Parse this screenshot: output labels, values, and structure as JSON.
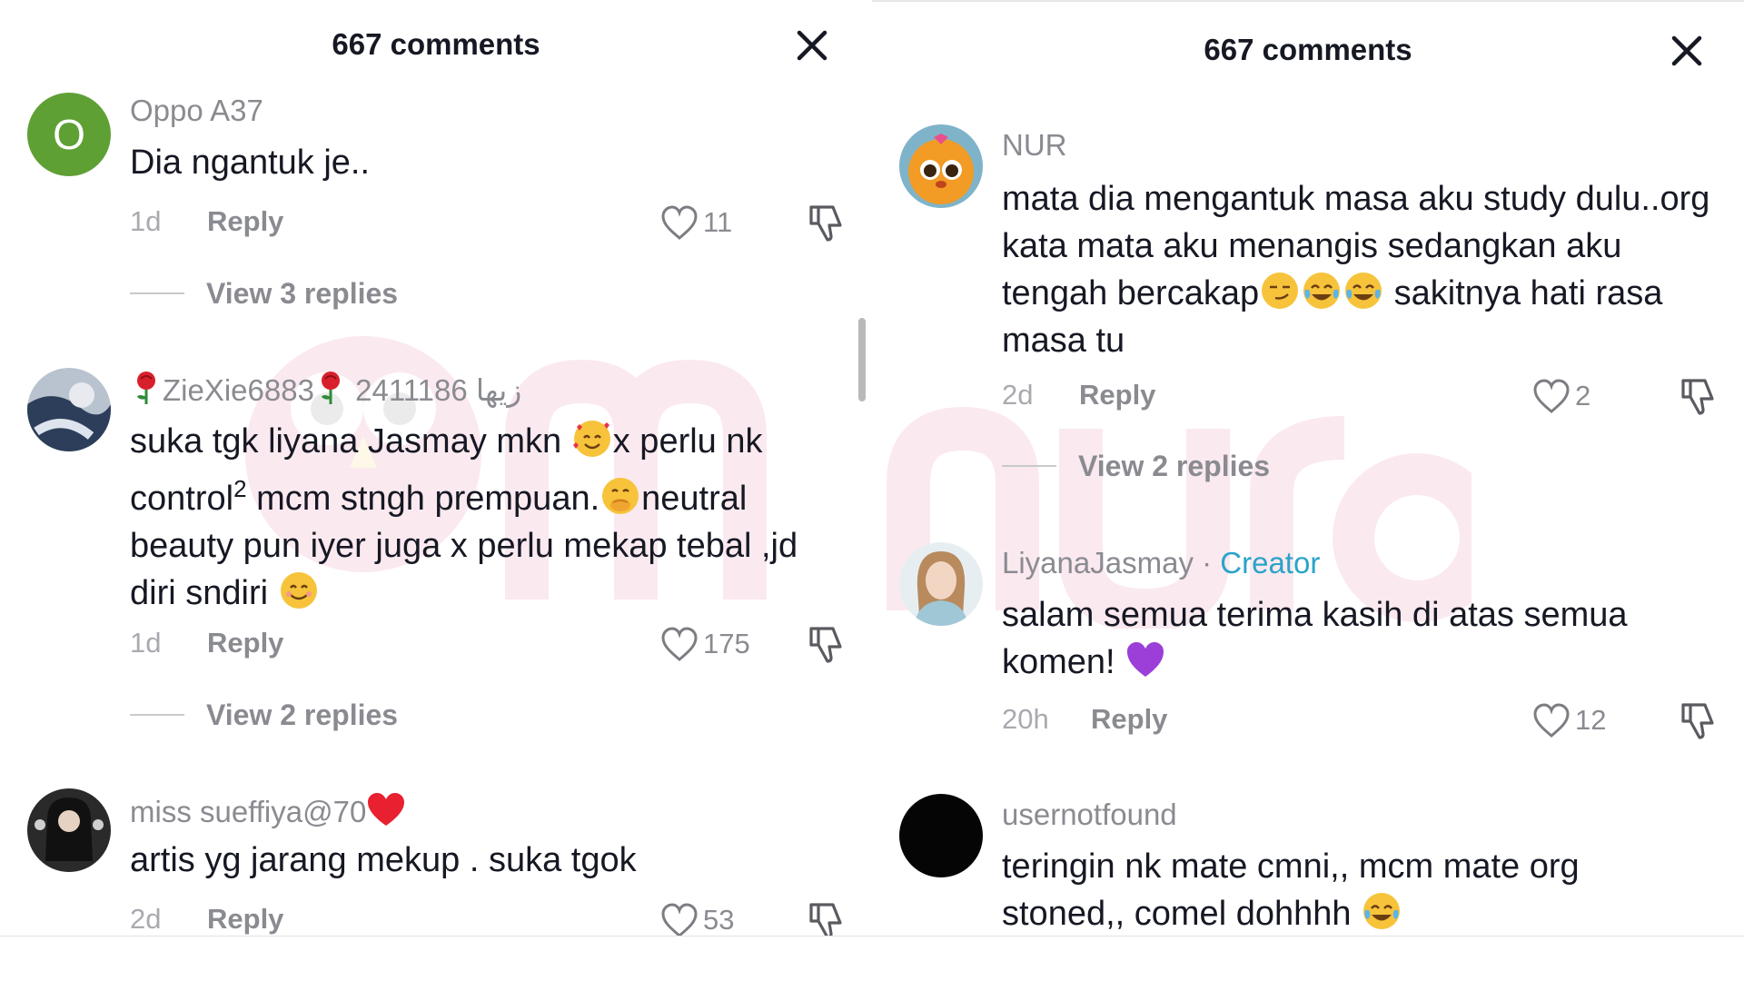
{
  "left_panel": {
    "title": "667 comments",
    "comments": [
      {
        "avatar_letter": "O",
        "username": "Oppo A37",
        "text": "Dia ngantuk je..",
        "time": "1d",
        "reply": "Reply",
        "likes": "11",
        "view_replies": "View 3 replies"
      },
      {
        "username_parts": [
          "ZieXie6883",
          "2411186 زيها"
        ],
        "text_parts": [
          "suka tgk liyana Jasmay mkn ",
          "x perlu nk control",
          "2",
          " mcm stngh prempuan.",
          "neutral beauty pun iyer juga x perlu mekap tebal ,jd diri sndiri "
        ],
        "time": "1d",
        "reply": "Reply",
        "likes": "175",
        "view_replies": "View 2 replies"
      },
      {
        "username": "miss sueffiya@70",
        "text": "artis yg jarang mekup . suka tgok",
        "time": "2d",
        "reply": "Reply",
        "likes": "53"
      }
    ]
  },
  "right_panel": {
    "title": "667 comments",
    "comments": [
      {
        "username": "NUR",
        "text_parts": [
          "mata dia mengantuk masa aku study dulu..org kata mata aku menangis sedangkan aku tengah bercakap",
          "sakitnya hati rasa masa tu"
        ],
        "time": "2d",
        "reply": "Reply",
        "likes": "2",
        "view_replies": "View 2 replies"
      },
      {
        "username": "LiyanaJasmay",
        "separator": " · ",
        "badge": "Creator",
        "text": "salam semua terima kasih di atas semua komen! ",
        "time": "20h",
        "reply": "Reply",
        "likes": "12"
      },
      {
        "username": "usernotfound",
        "text": "teringin nk mate cmni,, mcm mate org stoned,, comel dohhhh "
      }
    ]
  },
  "watermark_text": "murai",
  "colors": {
    "text": "#161823",
    "muted": "#8a8b91",
    "creator": "#2aa4c9",
    "avatar_green": "#5fa035"
  },
  "icons": [
    "close-icon",
    "heart-outline-icon",
    "dislike-icon",
    "rose-emoji",
    "red-heart-emoji",
    "smiling-face-with-hearts-emoji",
    "hand-over-mouth-emoji",
    "smiling-face-emoji",
    "smirk-emoji",
    "tears-of-joy-emoji",
    "purple-heart-emoji"
  ]
}
